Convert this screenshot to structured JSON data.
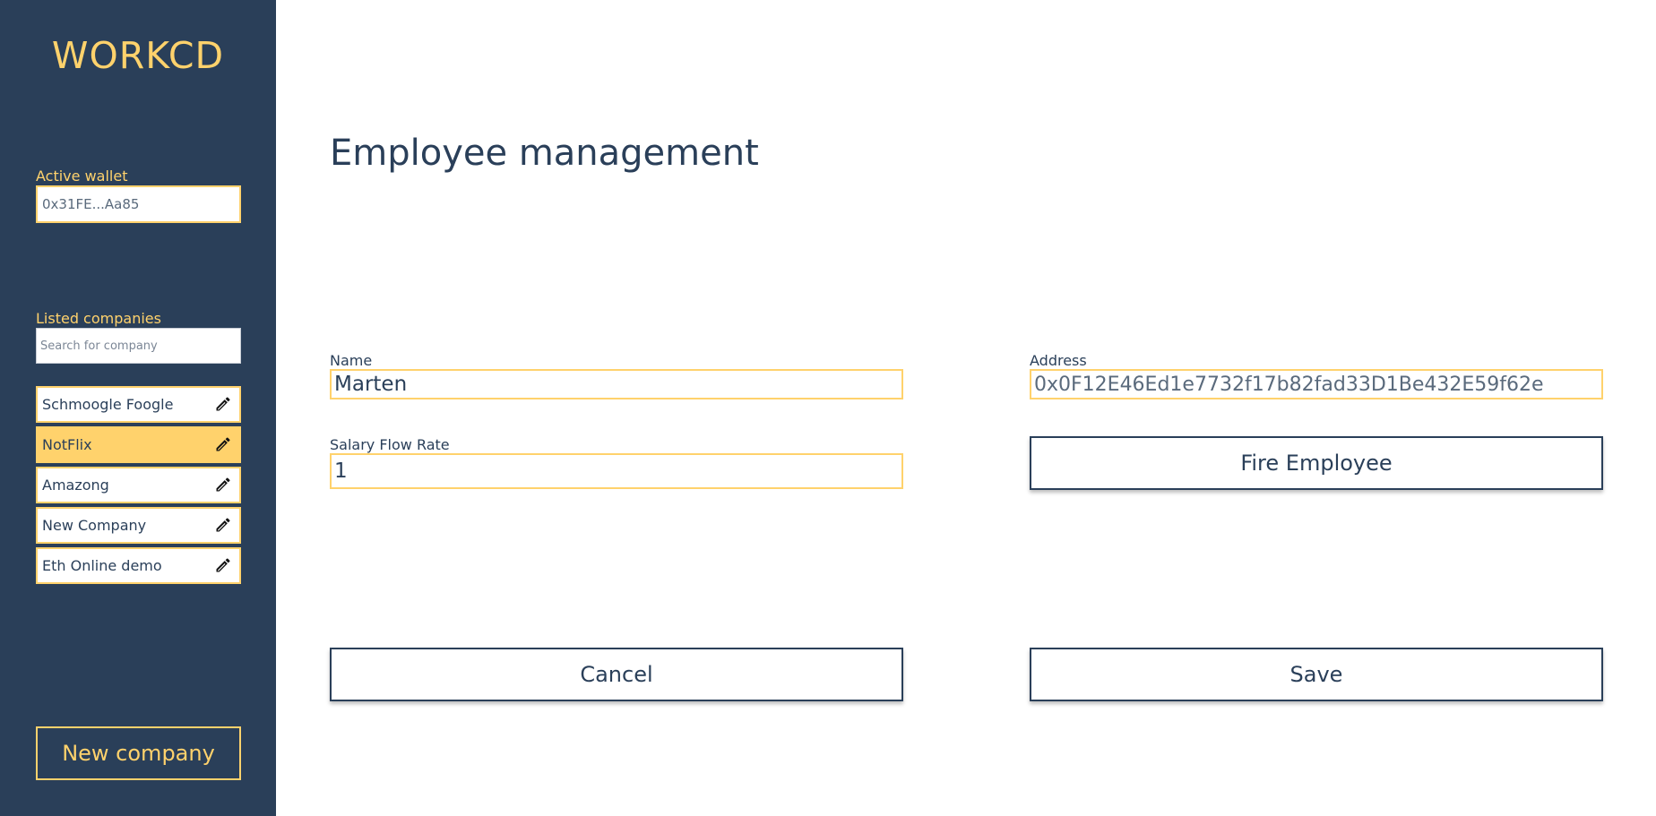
{
  "app": {
    "brand": "WORKCD"
  },
  "sidebar": {
    "wallet_label": "Active wallet",
    "wallet_value": "0x31FE...Aa85",
    "companies_label": "Listed companies",
    "search_placeholder": "Search for company",
    "companies": [
      {
        "name": "Schmoogle Foogle",
        "active": false,
        "icon": "pencil-icon"
      },
      {
        "name": "NotFlix",
        "active": true,
        "icon": "pencil-icon"
      },
      {
        "name": "Amazong",
        "active": false,
        "icon": "pencil-icon"
      },
      {
        "name": "New Company",
        "active": false,
        "icon": "pencil-icon"
      },
      {
        "name": "Eth Online demo",
        "active": false,
        "icon": "pencil-icon"
      }
    ],
    "new_company_label": "New company"
  },
  "main": {
    "title": "Employee management",
    "form": {
      "name_label": "Name",
      "name_value": "Marten",
      "salary_label": "Salary Flow Rate",
      "salary_value": "1",
      "address_label": "Address",
      "address_value": "0x0F12E46Ed1e7732f17b82fad33D1Be432E59f62e"
    },
    "buttons": {
      "fire": "Fire Employee",
      "cancel": "Cancel",
      "save": "Save"
    }
  },
  "colors": {
    "sidebar_bg": "#2a3f59",
    "accent": "#ffd26c",
    "text": "#2a3f59"
  }
}
